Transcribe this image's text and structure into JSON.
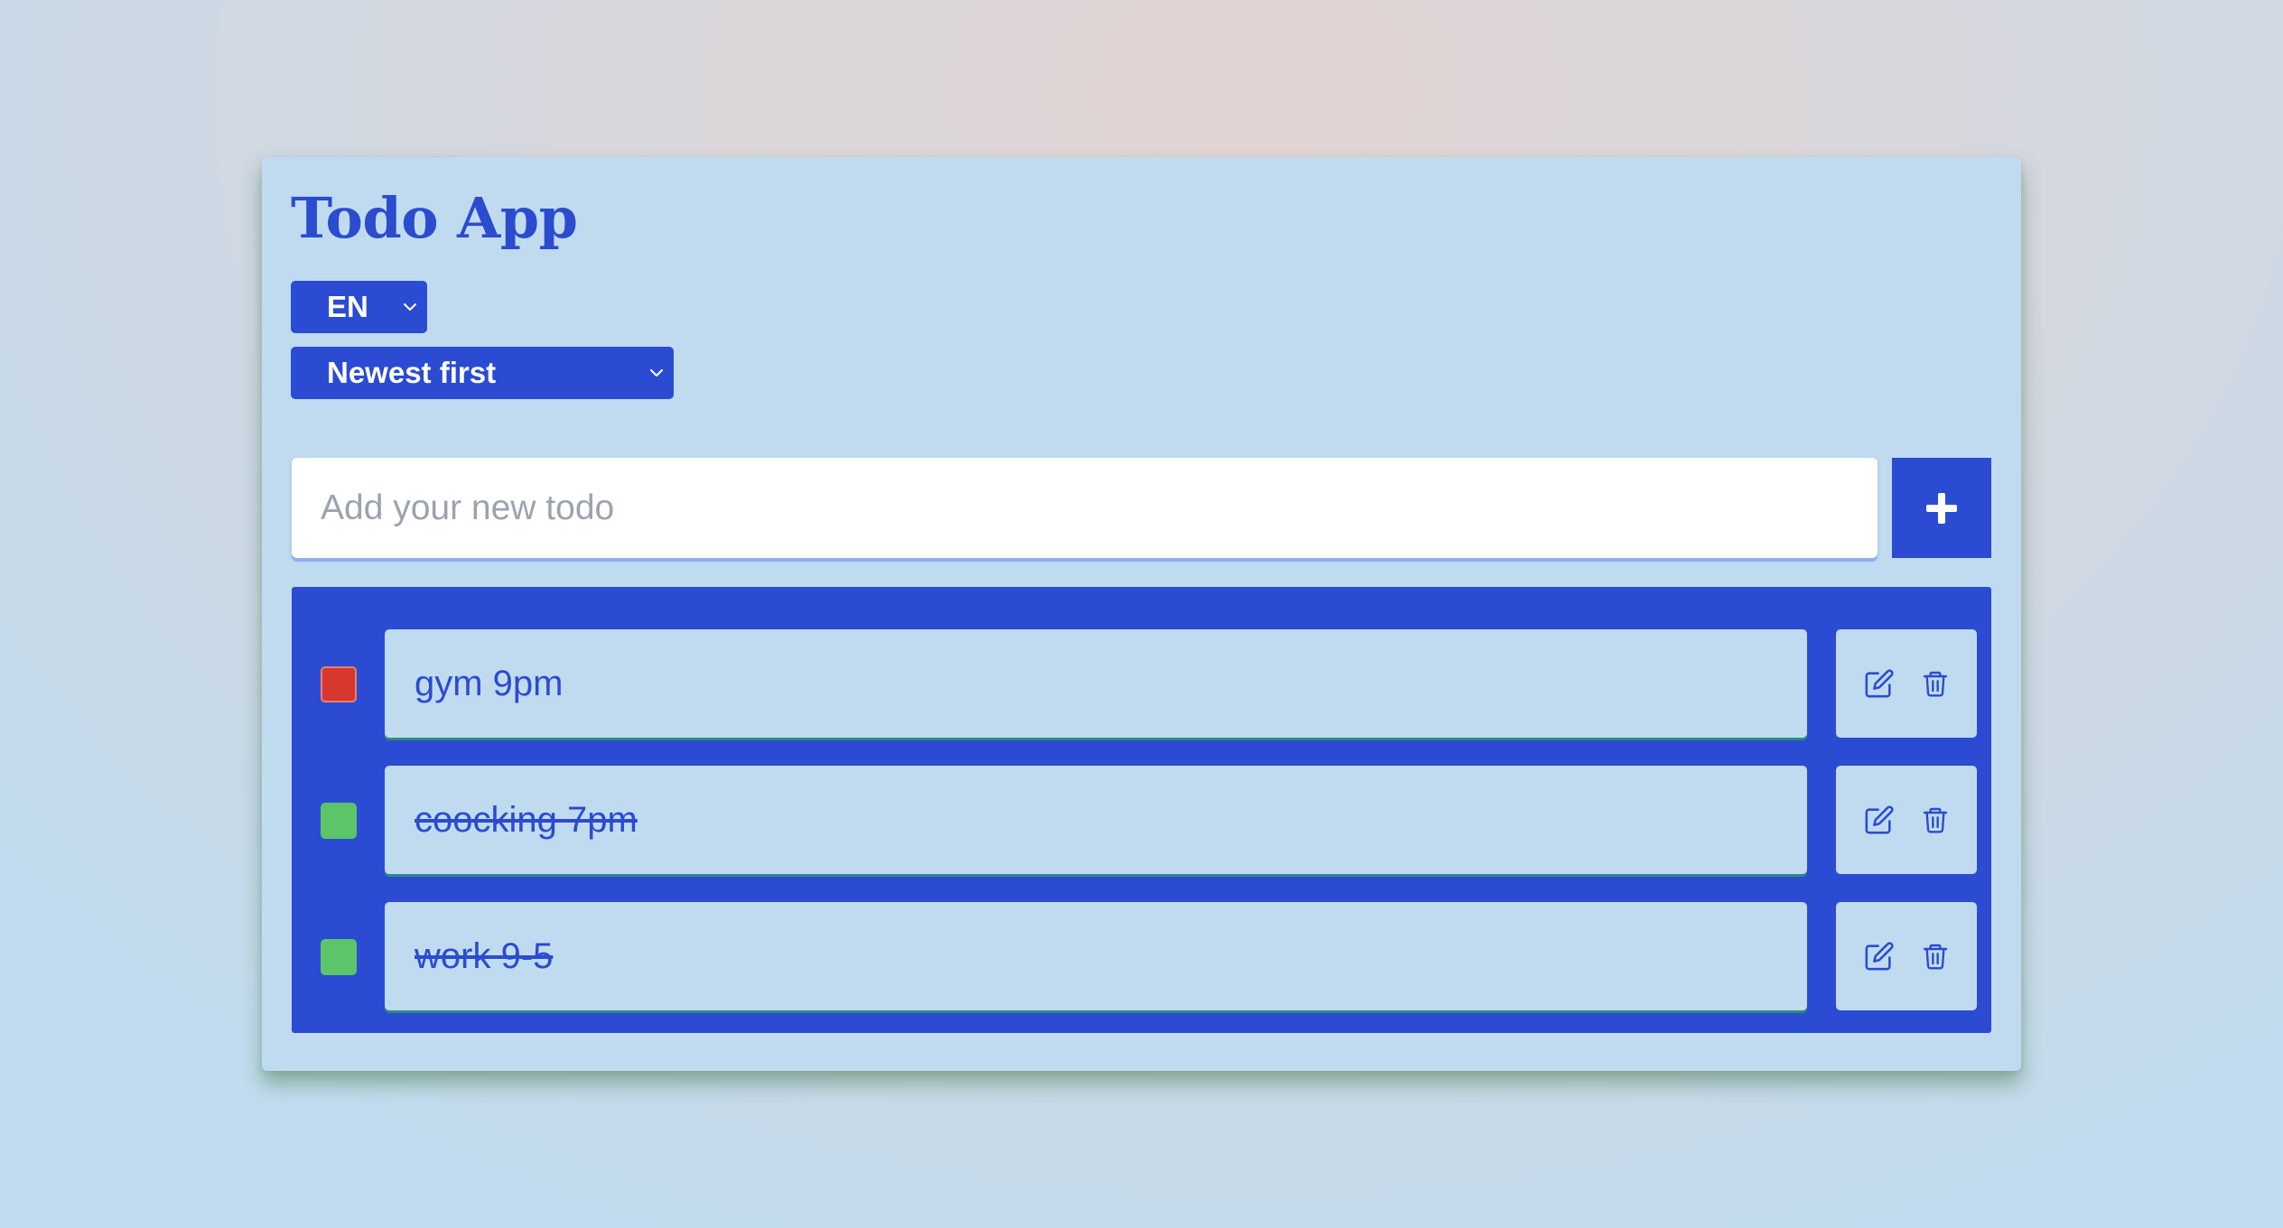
{
  "app": {
    "title": "Todo App"
  },
  "controls": {
    "language": {
      "selected": "EN"
    },
    "sort": {
      "selected": "Newest first"
    }
  },
  "new_todo": {
    "placeholder": "Add your new todo",
    "value": "",
    "add_icon": "plus-icon"
  },
  "todos": [
    {
      "text": "gym 9pm",
      "completed": false,
      "status_color": "#d6372e"
    },
    {
      "text": "coocking 7pm",
      "completed": true,
      "status_color": "#5cc56a"
    },
    {
      "text": "work 9-5",
      "completed": true,
      "status_color": "#5cc56a"
    }
  ],
  "row_icons": {
    "edit": "edit-icon",
    "delete": "trash-icon"
  },
  "colors": {
    "accent": "#2b4cd2",
    "card_background": "#c0dbf0",
    "pending": "#d6372e",
    "done": "#5cc56a"
  }
}
